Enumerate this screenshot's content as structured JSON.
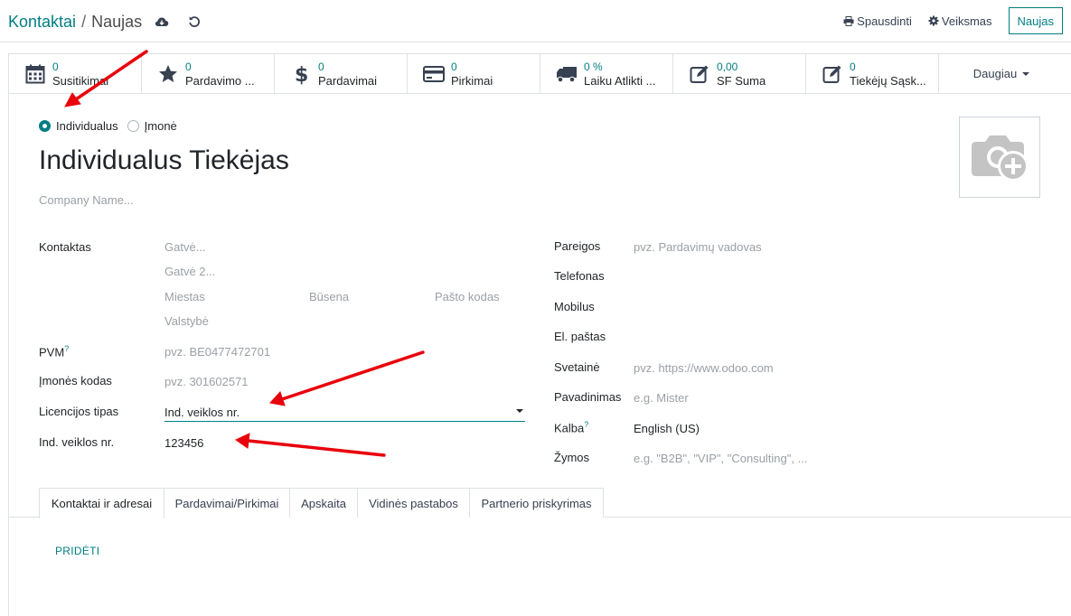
{
  "breadcrumb": {
    "parent": "Kontaktai",
    "separator": "/",
    "current": "Naujas"
  },
  "actions": {
    "print": "Spausdinti",
    "actions": "Veiksmas",
    "new": "Naujas"
  },
  "stats": [
    {
      "value": "0",
      "label": "Susitikimai",
      "icon": "calendar-icon"
    },
    {
      "value": "0",
      "label": "Pardavimo ...",
      "icon": "star-icon"
    },
    {
      "value": "0",
      "label": "Pardavimai",
      "icon": "dollar-icon"
    },
    {
      "value": "0",
      "label": "Pirkimai",
      "icon": "credit-card-icon"
    },
    {
      "value": "0 %",
      "label": "Laiku Atlikti ...",
      "icon": "truck-icon"
    },
    {
      "value": "0,00",
      "label": "SF Suma",
      "icon": "edit-icon"
    },
    {
      "value": "0",
      "label": "Tiekėjų Sąsk...",
      "icon": "edit-icon"
    }
  ],
  "more": "Daugiau",
  "company_type": {
    "individual": "Individualus",
    "company": "Įmonė",
    "selected": "Individualus"
  },
  "partner": {
    "name": "Individualus Tiekėjas",
    "company_placeholder": "Company Name..."
  },
  "left_fields": {
    "contact_label": "Kontaktas",
    "street_ph": "Gatvė...",
    "street2_ph": "Gatvė 2...",
    "city_ph": "Miestas",
    "state_ph": "Būsena",
    "zip_ph": "Pašto kodas",
    "country_ph": "Valstybė",
    "vat_label": "PVM",
    "vat_help": "?",
    "vat_ph": "pvz. BE0477472701",
    "company_code_label": "Įmonės kodas",
    "company_code_ph": "pvz. 301602571",
    "license_label": "Licencijos tipas",
    "license_value": "Ind. veiklos nr.",
    "ind_label": "Ind. veiklos nr.",
    "ind_value": "123456"
  },
  "right_fields": {
    "job_label": "Pareigos",
    "job_ph": "pvz. Pardavimų vadovas",
    "phone_label": "Telefonas",
    "mobile_label": "Mobilus",
    "email_label": "El. paštas",
    "website_label": "Svetainė",
    "website_ph": "pvz. https://www.odoo.com",
    "title_label": "Pavadinimas",
    "title_ph": "e.g. Mister",
    "lang_label": "Kalba",
    "lang_help": "?",
    "lang_value": "English (US)",
    "tags_label": "Žymos",
    "tags_ph": "e.g. \"B2B\", \"VIP\", \"Consulting\", ..."
  },
  "tabs": [
    {
      "label": "Kontaktai ir adresai",
      "active": true
    },
    {
      "label": "Pardavimai/Pirkimai",
      "active": false
    },
    {
      "label": "Apskaita",
      "active": false
    },
    {
      "label": "Vidinės pastabos",
      "active": false
    },
    {
      "label": "Partnerio priskyrimas",
      "active": false
    }
  ],
  "add_link": "PRIDĖTI",
  "colors": {
    "accent": "#017e84",
    "annotation": "#e8000b"
  }
}
